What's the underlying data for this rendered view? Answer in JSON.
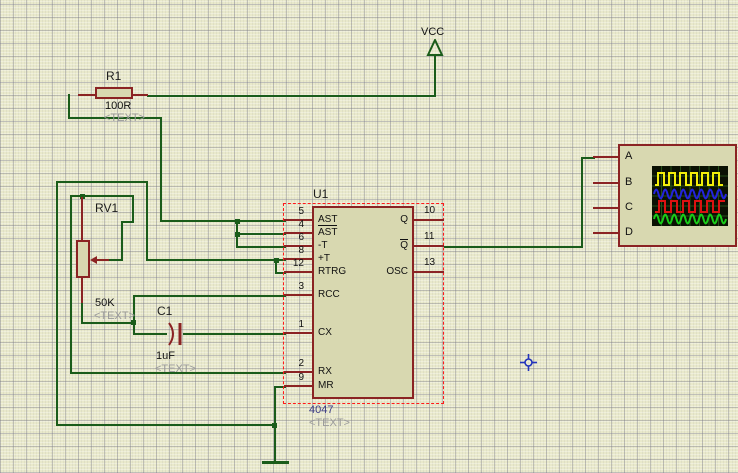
{
  "schematic": {
    "r1": {
      "ref": "R1",
      "value": "100R",
      "placeholder": "<TEXT>"
    },
    "rv1": {
      "ref": "RV1",
      "value": "50K",
      "placeholder": "<TEXT>"
    },
    "c1": {
      "ref": "C1",
      "value": "1uF",
      "placeholder": "<TEXT>"
    },
    "u1": {
      "ref": "U1",
      "part": "4047",
      "placeholder": "<TEXT>",
      "left_pins": [
        {
          "num": "5",
          "label": "AST"
        },
        {
          "num": "4",
          "label": "AST"
        },
        {
          "num": "6",
          "label": "-T"
        },
        {
          "num": "8",
          "label": "+T"
        },
        {
          "num": "12",
          "label": "RTRG"
        },
        {
          "num": "3",
          "label": "RCC"
        },
        {
          "num": "1",
          "label": "CX"
        },
        {
          "num": "2",
          "label": "RX"
        },
        {
          "num": "9",
          "label": "MR"
        }
      ],
      "right_pins": [
        {
          "num": "10",
          "label": "Q"
        },
        {
          "num": "11",
          "label": "Q"
        },
        {
          "num": "13",
          "label": "OSC"
        }
      ]
    },
    "power": {
      "vcc_label": "VCC"
    },
    "oscilloscope": {
      "channels": [
        "A",
        "B",
        "C",
        "D"
      ]
    },
    "colors": {
      "wire_green": "#1a5c1a",
      "component_maroon": "#8b2323",
      "component_fill": "#d8d8b0",
      "selection_red": "#ff1a1a",
      "screen_bg": "#0b1103",
      "screen_grid": "#245018",
      "wave_yellow": "#f2ee0a",
      "wave_blue": "#2323dd",
      "wave_red": "#dd1111",
      "wave_green": "#19cc19",
      "crosshair_blue": "#2233bb"
    }
  }
}
